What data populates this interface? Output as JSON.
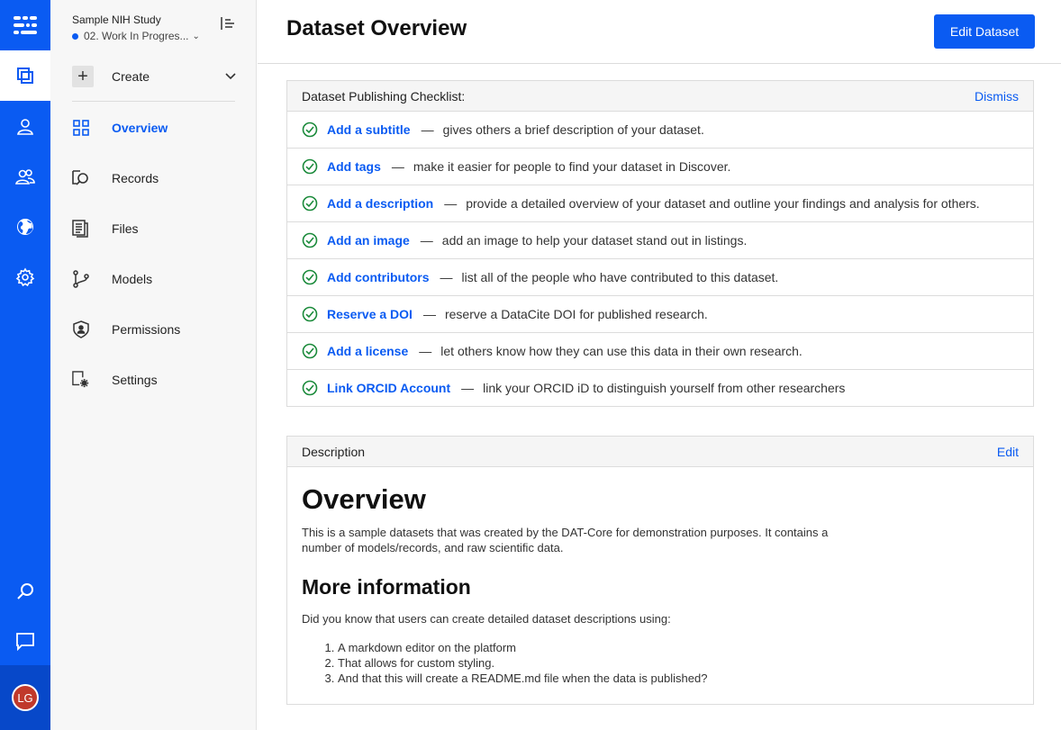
{
  "colors": {
    "accent": "#0a5bf2",
    "avatar": "#c0392b",
    "check": "#1a8a3a"
  },
  "org": {
    "name": "Sample NIH Study",
    "status": "02. Work In Progres...",
    "caret": "⌄"
  },
  "create": {
    "label": "Create",
    "plus": "+",
    "chevron": "⌄"
  },
  "nav": [
    {
      "label": "Overview",
      "icon": "grid-icon"
    },
    {
      "label": "Records",
      "icon": "records-search-icon"
    },
    {
      "label": "Files",
      "icon": "files-icon"
    },
    {
      "label": "Models",
      "icon": "models-icon"
    },
    {
      "label": "Permissions",
      "icon": "shield-icon"
    },
    {
      "label": "Settings",
      "icon": "settings-doc-icon"
    }
  ],
  "user": {
    "initials": "LG"
  },
  "header": {
    "title": "Dataset Overview",
    "edit_button": "Edit Dataset"
  },
  "checklist": {
    "title": "Dataset Publishing Checklist:",
    "dismiss": "Dismiss",
    "dash": "—",
    "items": [
      {
        "link": "Add a subtitle",
        "text": "gives others a brief description of your dataset."
      },
      {
        "link": "Add tags",
        "text": "make it easier for people to find your dataset in Discover."
      },
      {
        "link": "Add a description",
        "text": "provide a detailed overview of your dataset and outline your findings and analysis for others."
      },
      {
        "link": "Add an image",
        "text": "add an image to help your dataset stand out in listings."
      },
      {
        "link": "Add contributors",
        "text": "list all of the people who have contributed to this dataset."
      },
      {
        "link": "Reserve a DOI",
        "text": "reserve a DataCite DOI for published research."
      },
      {
        "link": "Add a license",
        "text": "let others know how they can use this data in their own research."
      },
      {
        "link": "Link ORCID Account",
        "text": "link your ORCID iD to distinguish yourself from other researchers"
      }
    ]
  },
  "description": {
    "title": "Description",
    "edit": "Edit",
    "h1": "Overview",
    "p1": "This is a sample datasets that was created by the DAT-Core for demonstration purposes. It contains a number of models/records, and raw scientific data.",
    "h2": "More information",
    "p2": "Did you know that users can create detailed dataset descriptions using:",
    "list": [
      "A markdown editor on the platform",
      "That allows for custom styling.",
      "And that this will create a README.md file when the data is published?"
    ]
  }
}
